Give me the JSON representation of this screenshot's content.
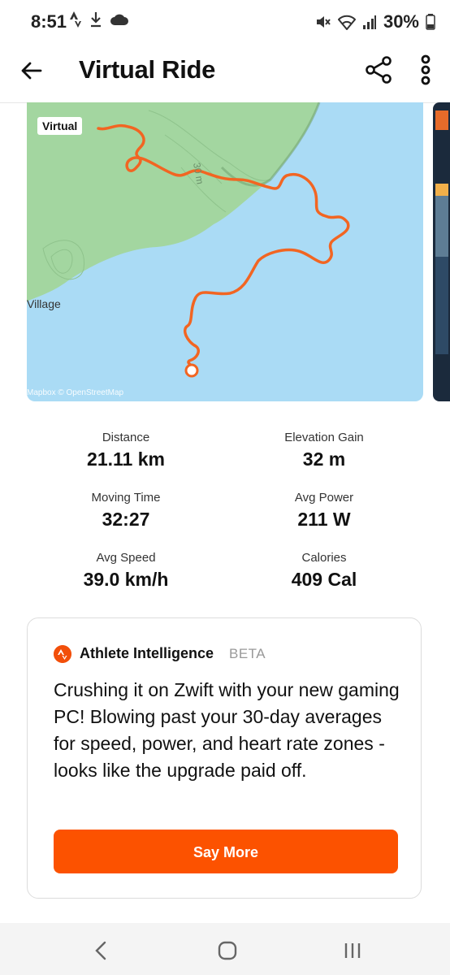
{
  "status_bar": {
    "time": "8:51",
    "battery": "30%"
  },
  "header": {
    "title": "Virtual Ride"
  },
  "map": {
    "tag": "Virtual",
    "place_label": "Village",
    "attribution": "Mapbox © OpenStreetMap"
  },
  "stats": [
    {
      "label": "Distance",
      "value": "21.11 km"
    },
    {
      "label": "Elevation Gain",
      "value": "32 m"
    },
    {
      "label": "Moving Time",
      "value": "32:27"
    },
    {
      "label": "Avg Power",
      "value": "211 W"
    },
    {
      "label": "Avg Speed",
      "value": "39.0 km/h"
    },
    {
      "label": "Calories",
      "value": "409 Cal"
    }
  ],
  "ai_card": {
    "title": "Athlete Intelligence",
    "badge": "BETA",
    "text": "Crushing it on Zwift with your new gaming PC! Blowing past your 30-day averages for speed, power, and heart rate zones - looks like the upgrade paid off.",
    "button": "Say More"
  },
  "colors": {
    "brand": "#fc5200",
    "water": "#aadbf5",
    "land": "#a3d6a0",
    "route": "#f26522"
  },
  "icons": [
    "back-arrow-icon",
    "share-icon",
    "more-vertical-icon",
    "athlete-intelligence-icon",
    "nav-back-icon",
    "nav-home-icon",
    "nav-recents-icon"
  ]
}
